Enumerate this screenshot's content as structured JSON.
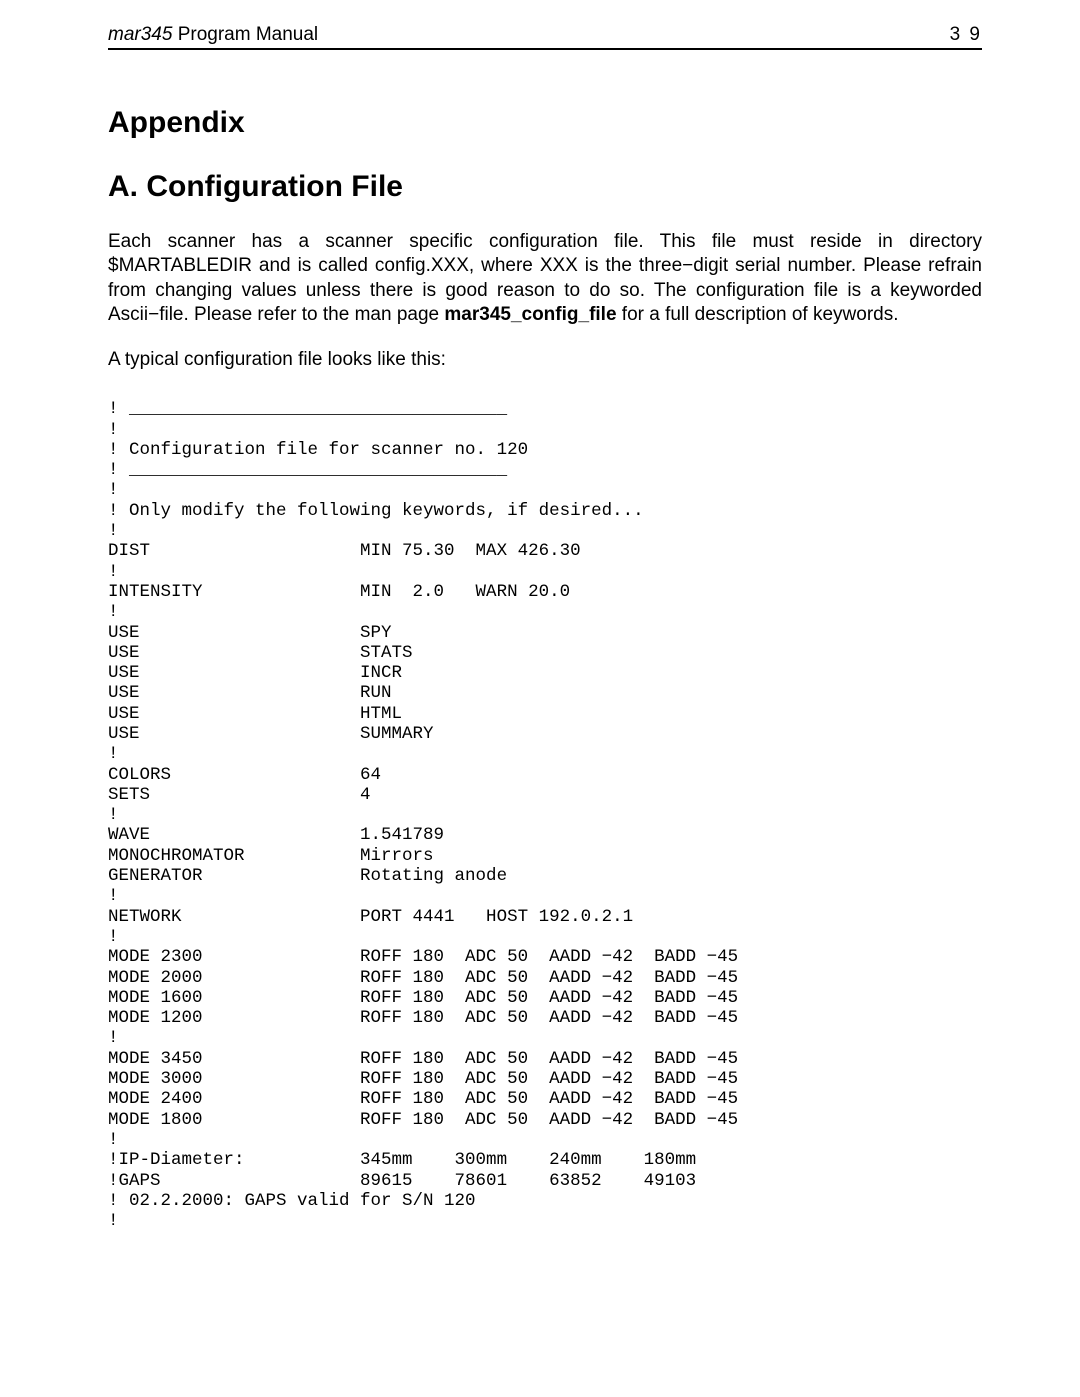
{
  "header": {
    "title_italic": "mar345",
    "title_rest": " Program Manual",
    "page_number": "3 9"
  },
  "headings": {
    "appendix": "Appendix",
    "section": "A. Configuration File"
  },
  "paragraphs": {
    "p1_a": "Each scanner has a scanner specific configuration file. This file must reside in directory $MARTABLEDIR and is called config.XXX, where XXX is the three−digit serial number. Please refrain from changing values unless there is good reason to do so. The configuration file is a keyworded Ascii−file. Please refer to the man page ",
    "p1_bold": "mar345_config_file",
    "p1_b": " for a full description of keywords.",
    "p2": "A typical configuration file looks like this:"
  },
  "config_file": "! ____________________________________\n!\n! Configuration file for scanner no. 120\n! ____________________________________\n!\n! Only modify the following keywords, if desired...\n!\nDIST                    MIN 75.30  MAX 426.30\n!\nINTENSITY               MIN  2.0   WARN 20.0\n!\nUSE                     SPY\nUSE                     STATS\nUSE                     INCR\nUSE                     RUN\nUSE                     HTML\nUSE                     SUMMARY\n!\nCOLORS                  64\nSETS                    4\n!\nWAVE                    1.541789\nMONOCHROMATOR           Mirrors\nGENERATOR               Rotating anode\n!\nNETWORK                 PORT 4441   HOST 192.0.2.1\n!\nMODE 2300               ROFF 180  ADC 50  AADD −42  BADD −45\nMODE 2000               ROFF 180  ADC 50  AADD −42  BADD −45\nMODE 1600               ROFF 180  ADC 50  AADD −42  BADD −45\nMODE 1200               ROFF 180  ADC 50  AADD −42  BADD −45\n!\nMODE 3450               ROFF 180  ADC 50  AADD −42  BADD −45\nMODE 3000               ROFF 180  ADC 50  AADD −42  BADD −45\nMODE 2400               ROFF 180  ADC 50  AADD −42  BADD −45\nMODE 1800               ROFF 180  ADC 50  AADD −42  BADD −45\n!\n!IP-Diameter:           345mm    300mm    240mm    180mm\n!GAPS                   89615    78601    63852    49103\n! 02.2.2000: GAPS valid for S/N 120\n!"
}
